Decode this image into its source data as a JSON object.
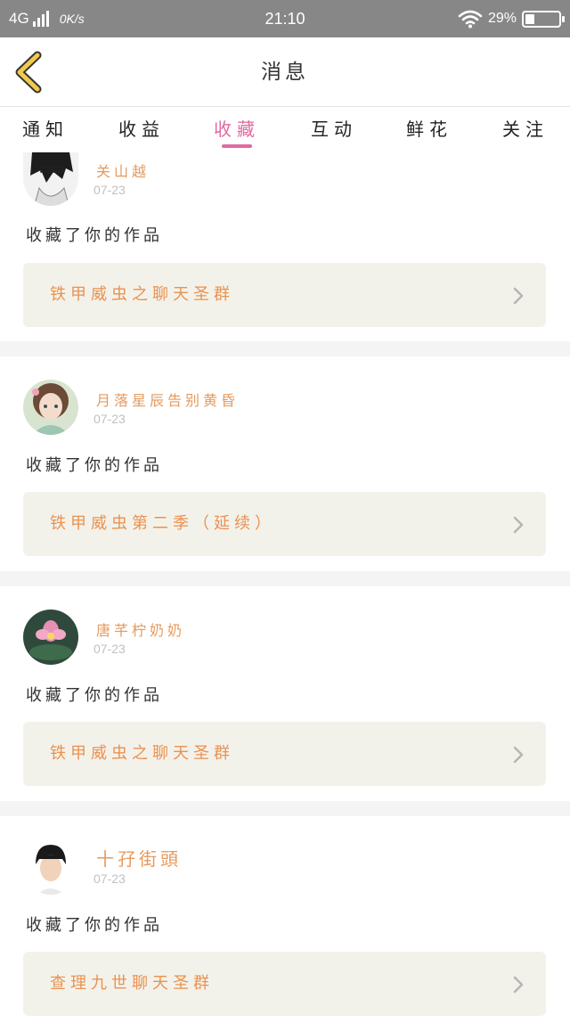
{
  "status_bar": {
    "network": "4G",
    "speed": "0K/s",
    "time": "21:10",
    "battery_percent": "29%",
    "battery_level": 0.29,
    "icons": [
      "signal-icon",
      "wifi-icon",
      "battery-icon"
    ]
  },
  "header": {
    "title": "消息",
    "back_icon": "chevron-left-icon",
    "accent_color": "#f2c94c"
  },
  "tabs": [
    {
      "label": "通知",
      "active": false
    },
    {
      "label": "收益",
      "active": false
    },
    {
      "label": "收藏",
      "active": true
    },
    {
      "label": "互动",
      "active": false
    },
    {
      "label": "鲜花",
      "active": false
    },
    {
      "label": "关注",
      "active": false
    }
  ],
  "colors": {
    "active_tab": "#e06aa0",
    "username": "#e59a5f",
    "work_title": "#ea9250",
    "work_bg": "#f3f2ea"
  },
  "items": [
    {
      "username": "关山越",
      "date": "07-23",
      "action": "收藏了你的作品",
      "work": "铁甲威虫之聊天圣群"
    },
    {
      "username": "月落星辰告别黄昏",
      "date": "07-23",
      "action": "收藏了你的作品",
      "work": "铁甲威虫第二季（延续）"
    },
    {
      "username": "唐芊柠奶奶",
      "date": "07-23",
      "action": "收藏了你的作品",
      "work": "铁甲威虫之聊天圣群"
    },
    {
      "username": "十孖街頭",
      "date": "07-23",
      "action": "收藏了你的作品",
      "work": "查理九世聊天圣群"
    }
  ]
}
